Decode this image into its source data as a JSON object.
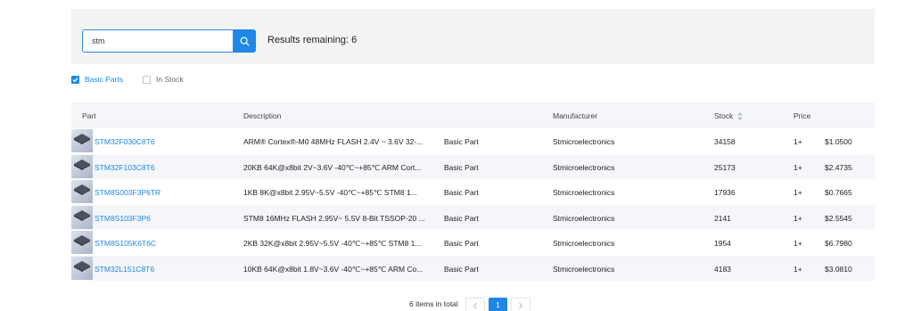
{
  "search": {
    "value": "stm",
    "placeholder": ""
  },
  "results_label": "Results remaining: 6",
  "filters": [
    {
      "label": "Basic Parts",
      "checked": true
    },
    {
      "label": "In Stock",
      "checked": false
    }
  ],
  "table": {
    "headers": {
      "part": "Part",
      "description": "Description",
      "manufacturer": "Manufacturer",
      "stock": "Stock",
      "price": "Price"
    },
    "rows": [
      {
        "part": "STM32F030C8T6",
        "description": "ARM® Cortex®-M0 48MHz FLASH 2.4V ~ 3.6V 32-...",
        "type": "Basic Part",
        "manufacturer": "Stmicroelectronics",
        "stock": "34158",
        "qty": "1+",
        "price": "$1.0500"
      },
      {
        "part": "STM32F103C8T6",
        "description": "20KB 64K@x8bit 2V~3.6V -40℃~+85℃ ARM Cort...",
        "type": "Basic Part",
        "manufacturer": "Stmicroelectronics",
        "stock": "25173",
        "qty": "1+",
        "price": "$2.4735"
      },
      {
        "part": "STM8S003F3P6TR",
        "description": "1KB 8K@x8bit 2.95V~5.5V -40℃~+85℃ STM8 1...",
        "type": "Basic Part",
        "manufacturer": "Stmicroelectronics",
        "stock": "17936",
        "qty": "1+",
        "price": "$0.7665"
      },
      {
        "part": "STM8S103F3P6",
        "description": "STM8 16MHz FLASH 2.95V~ 5.5V 8-Bit TSSOP-20 ...",
        "type": "Basic Part",
        "manufacturer": "Stmicroelectronics",
        "stock": "2141",
        "qty": "1+",
        "price": "$2.5545"
      },
      {
        "part": "STM8S105K6T6C",
        "description": "2KB 32K@x8bit 2.95V~5.5V -40℃~+85℃ STM8 1...",
        "type": "Basic Part",
        "manufacturer": "Stmicroelectronics",
        "stock": "1954",
        "qty": "1+",
        "price": "$6.7980"
      },
      {
        "part": "STM32L151C8T6",
        "description": "10KB 64K@x8bit 1.8V~3.6V -40℃~+85℃ ARM Co...",
        "type": "Basic Part",
        "manufacturer": "Stmicroelectronics",
        "stock": "4183",
        "qty": "1+",
        "price": "$3.0810"
      }
    ]
  },
  "pagination": {
    "total_label": "6 items in total",
    "current_page": "1"
  },
  "colors": {
    "accent": "#1f87e5",
    "panel": "#f2f3f5",
    "stripe": "#f4f6f9"
  }
}
